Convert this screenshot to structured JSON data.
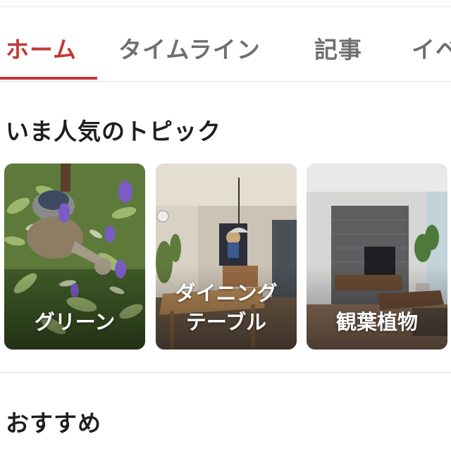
{
  "tabs": [
    {
      "label": "ホーム",
      "active": true
    },
    {
      "label": "タイムライン",
      "active": false
    },
    {
      "label": "記事",
      "active": false
    },
    {
      "label": "イベ",
      "active": false
    }
  ],
  "trending": {
    "title": "いま人気のトピック",
    "cards": [
      {
        "label": "グリーン"
      },
      {
        "label": "ダイニング\nテーブル"
      },
      {
        "label": "観葉植物"
      }
    ]
  },
  "recommend": {
    "title": "おすすめ"
  },
  "colors": {
    "accent": "#c33a36",
    "tab_inactive": "#6f6f6f",
    "text": "#1f1f1f"
  }
}
